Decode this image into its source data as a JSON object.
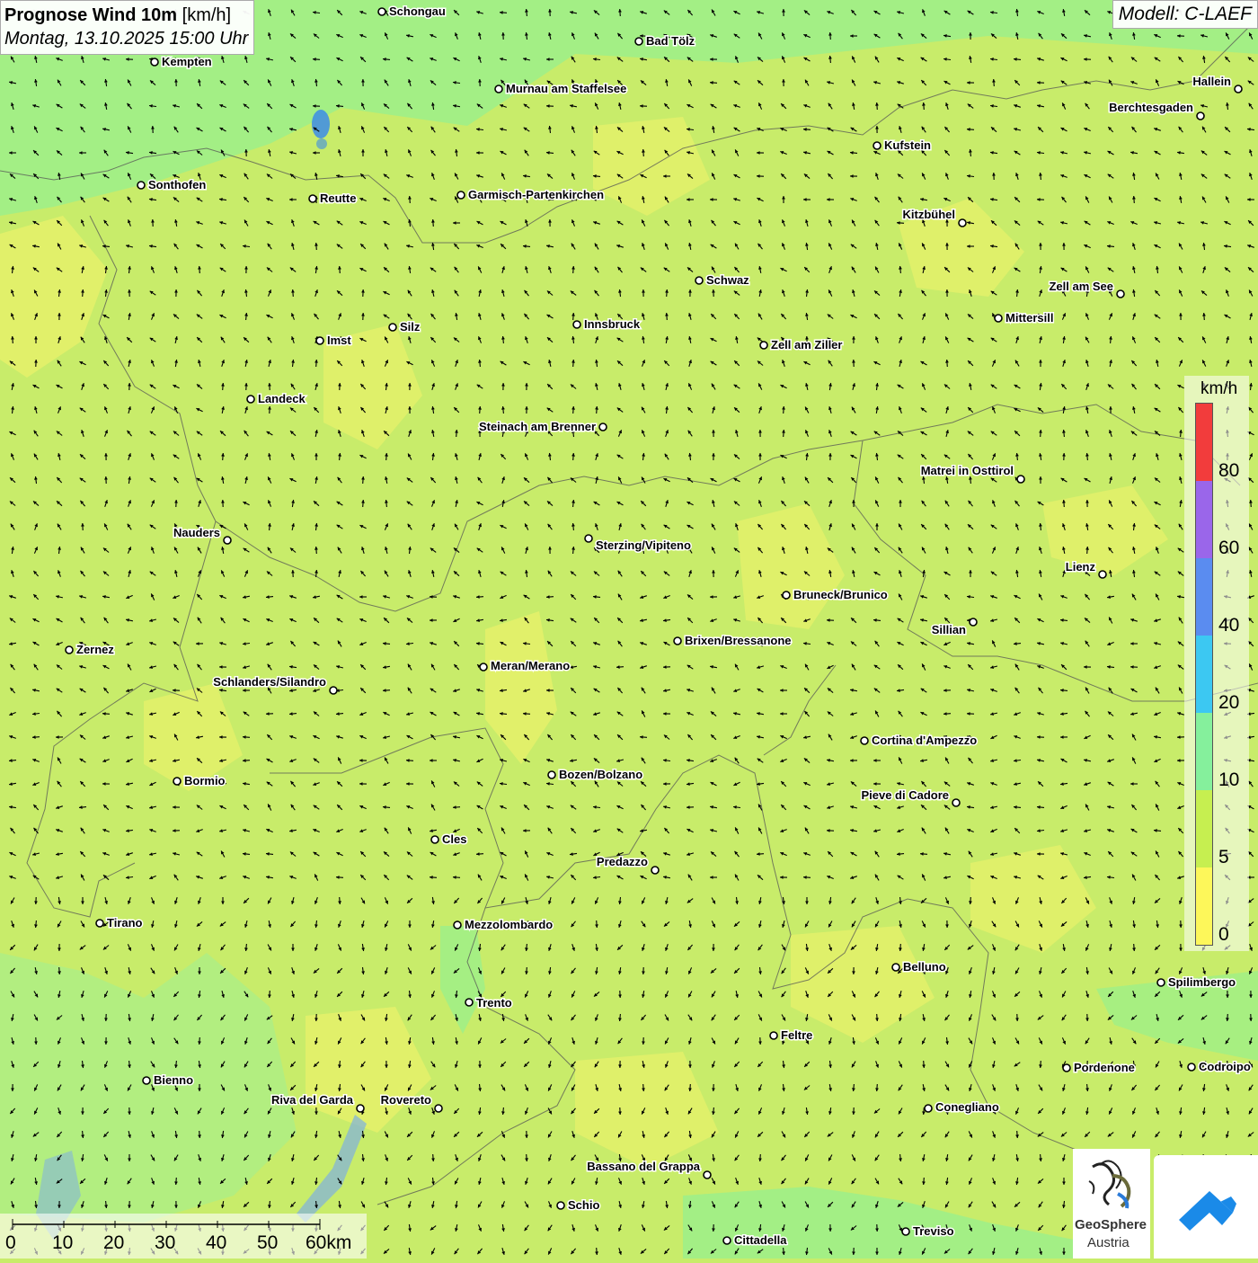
{
  "header": {
    "title_bold": "Prognose Wind 10m",
    "title_unit": "[km/h]",
    "subtitle": "Montag, 13.10.2025 15:00 Uhr",
    "model": "Modell: C-LAEF"
  },
  "legend": {
    "unit": "km/h",
    "ticks": [
      "0",
      "5",
      "10",
      "20",
      "40",
      "60",
      "80"
    ],
    "colors": [
      "#fdf75a",
      "#c6ef50",
      "#85f09c",
      "#3cc8f2",
      "#5a8cf0",
      "#9a66ea",
      "#f23c3c"
    ]
  },
  "scalebar": {
    "labels": [
      "0",
      "10",
      "20",
      "30",
      "40",
      "50",
      "60km"
    ]
  },
  "cities": [
    {
      "name": "Schongau"
    },
    {
      "name": "Kempten"
    },
    {
      "name": "Bad Tölz"
    },
    {
      "name": "Murnau am Staffelsee"
    },
    {
      "name": "Hallein"
    },
    {
      "name": "Berchtesgaden"
    },
    {
      "name": "Kufstein"
    },
    {
      "name": "Sonthofen"
    },
    {
      "name": "Reutte"
    },
    {
      "name": "Garmisch-Partenkirchen"
    },
    {
      "name": "Kitzbühel"
    },
    {
      "name": "Schwaz"
    },
    {
      "name": "Zell am See"
    },
    {
      "name": "Mittersill"
    },
    {
      "name": "Imst"
    },
    {
      "name": "Silz"
    },
    {
      "name": "Innsbruck"
    },
    {
      "name": "Zell am Ziller"
    },
    {
      "name": "Landeck"
    },
    {
      "name": "Steinach am Brenner"
    },
    {
      "name": "Matrei in Osttirol"
    },
    {
      "name": "Nauders"
    },
    {
      "name": "Sterzing/Vipiteno"
    },
    {
      "name": "Lienz"
    },
    {
      "name": "Bruneck/Brunico"
    },
    {
      "name": "Sillian"
    },
    {
      "name": "Brixen/Bressanone"
    },
    {
      "name": "Zernez"
    },
    {
      "name": "Meran/Merano"
    },
    {
      "name": "Schlanders/Silandro"
    },
    {
      "name": "Cortina d'Ampezzo"
    },
    {
      "name": "Bozen/Bolzano"
    },
    {
      "name": "Bormio"
    },
    {
      "name": "Pieve di Cadore"
    },
    {
      "name": "Cles"
    },
    {
      "name": "Predazzo"
    },
    {
      "name": "Tirano"
    },
    {
      "name": "Mezzolombardo"
    },
    {
      "name": "Belluno"
    },
    {
      "name": "Spilimbergo"
    },
    {
      "name": "Trento"
    },
    {
      "name": "Feltre"
    },
    {
      "name": "Pordenone"
    },
    {
      "name": "Codroipo"
    },
    {
      "name": "Bienno"
    },
    {
      "name": "Riva del Garda"
    },
    {
      "name": "Rovereto"
    },
    {
      "name": "Conegliano"
    },
    {
      "name": "Bassano del Grappa"
    },
    {
      "name": "Schio"
    },
    {
      "name": "Treviso"
    },
    {
      "name": "Cittadella"
    }
  ],
  "logos": {
    "geosphere_line1": "GeoSphere",
    "geosphere_line2": "Austria"
  }
}
